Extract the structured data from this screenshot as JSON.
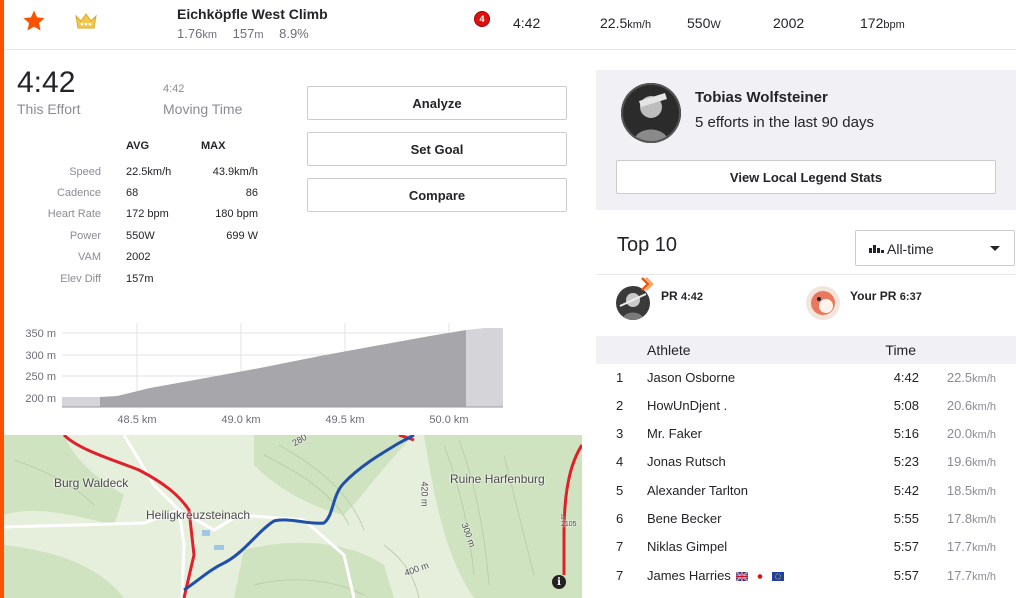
{
  "segment": {
    "name": "Eichköpfle West Climb",
    "distance_value": "1.76",
    "distance_unit": "km",
    "elevation_value": "157",
    "elevation_unit": "m",
    "grade": "8.9%",
    "badge_count": "4",
    "time": "4:42",
    "speed_value": "22.5",
    "speed_unit": "km/h",
    "power_value": "550",
    "power_unit": "W",
    "vam": "2002",
    "hr_value": "172",
    "hr_unit": "bpm"
  },
  "effort": {
    "time": "4:42",
    "time_label": "This Effort",
    "moving_time": "4:42",
    "moving_label": "Moving Time"
  },
  "stats": {
    "avg_header": "AVG",
    "max_header": "MAX",
    "rows": [
      {
        "label": "Speed",
        "avg": "22.5km/h",
        "max": "43.9km/h"
      },
      {
        "label": "Cadence",
        "avg": "68",
        "max": "86"
      },
      {
        "label": "Heart Rate",
        "avg": "172 bpm",
        "max": "180 bpm"
      },
      {
        "label": "Power",
        "avg": "550W",
        "max": "699 W"
      },
      {
        "label": "VAM",
        "avg": "2002",
        "max": ""
      },
      {
        "label": "Elev Diff",
        "avg": "157m",
        "max": ""
      }
    ]
  },
  "buttons": {
    "analyze": "Analyze",
    "set_goal": "Set Goal",
    "compare": "Compare"
  },
  "elevation_chart": {
    "y_ticks": [
      "350 m",
      "300 m",
      "250 m",
      "200 m"
    ],
    "x_ticks": [
      "48.5 km",
      "49.0 km",
      "49.5 km",
      "50.0 km"
    ]
  },
  "map": {
    "labels": {
      "burg": "Burg Waldeck",
      "town": "Heiligkreuzsteinach",
      "ruine": "Ruine Harfenburg",
      "c280": "280",
      "c420": "420 m",
      "c300": "300 m",
      "c400": "400 m",
      "road": "L 2105"
    },
    "info": "i"
  },
  "local_legend": {
    "name": "Tobias Wolfsteiner",
    "efforts": "5 efforts in the last 90 days",
    "button": "View Local Legend Stats"
  },
  "top10": {
    "title": "Top 10",
    "filter": "All-time",
    "pr_label": "PR",
    "pr_value": "4:42",
    "your_pr_label": "Your PR",
    "your_pr_value": "6:37",
    "col_athlete": "Athlete",
    "col_time": "Time",
    "rows": [
      {
        "rank": "1",
        "name": "Jason Osborne",
        "time": "4:42",
        "speed": "22.5",
        "unit": "km/h"
      },
      {
        "rank": "2",
        "name": "HowUnDjent .",
        "time": "5:08",
        "speed": "20.6",
        "unit": "km/h"
      },
      {
        "rank": "3",
        "name": "Mr. Faker",
        "time": "5:16",
        "speed": "20.0",
        "unit": "km/h"
      },
      {
        "rank": "4",
        "name": "Jonas Rutsch",
        "time": "5:23",
        "speed": "19.6",
        "unit": "km/h"
      },
      {
        "rank": "5",
        "name": "Alexander Tarlton",
        "time": "5:42",
        "speed": "18.5",
        "unit": "km/h"
      },
      {
        "rank": "6",
        "name": "Bene Becker",
        "time": "5:55",
        "speed": "17.8",
        "unit": "km/h"
      },
      {
        "rank": "7",
        "name": "Niklas Gimpel",
        "time": "5:57",
        "speed": "17.7",
        "unit": "km/h"
      },
      {
        "rank": "7",
        "name": "James Harries",
        "time": "5:57",
        "speed": "17.7",
        "unit": "km/h"
      }
    ]
  },
  "colors": {
    "accent": "#fc5200",
    "route_red": "#e0202a",
    "route_blue": "#1f4fa8",
    "panel_bg": "#f0f0f5"
  }
}
